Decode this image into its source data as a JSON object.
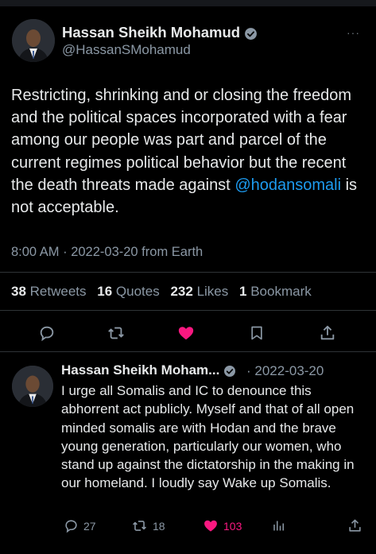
{
  "tweet": {
    "author_name": "Hassan Sheikh Mohamud",
    "handle": "@HassanSMohamud",
    "text_before": "Restricting, shrinking and or closing the freedom and the political spaces incorporated with a fear among our people was part and parcel of the current regimes political behavior but the recent the death threats made against ",
    "mention": "@hodansomali",
    "text_after": " is not acceptable.",
    "timestamp": "8:00 AM · 2022-03-20 from Earth",
    "stats": {
      "retweets_count": "38",
      "retweets_label": "Retweets",
      "quotes_count": "16",
      "quotes_label": "Quotes",
      "likes_count": "232",
      "likes_label": "Likes",
      "bookmarks_count": "1",
      "bookmarks_label": "Bookmark"
    },
    "icons": [
      "reply-icon",
      "retweet-icon",
      "like-icon",
      "bookmark-icon",
      "share-icon"
    ],
    "more_label": "···"
  },
  "reply": {
    "author_name": "Hassan Sheikh Moham...",
    "date": "· 2022-03-20",
    "text": "I urge all Somalis and IC to denounce this abhorrent act publicly. Myself and that of all open minded somalis are with Hodan and the brave young generation, particularly our women, who stand up against the dictatorship in the making in our homeland. I loudly say Wake up Somalis.",
    "replies": "27",
    "retweets": "18",
    "likes": "103"
  },
  "colors": {
    "background": "#000000",
    "text": "#e7e9ea",
    "secondary": "#8b98a5",
    "link": "#1d9bf0",
    "like": "#f91880",
    "divider": "#2f3336"
  }
}
